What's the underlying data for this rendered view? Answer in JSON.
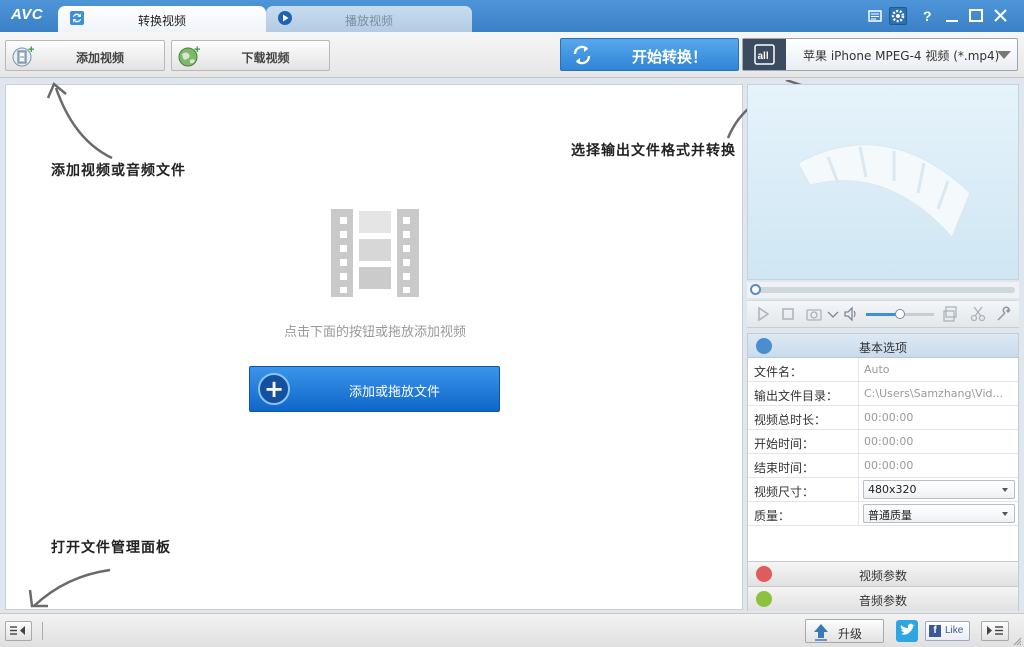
{
  "app": {
    "logo": "AVC"
  },
  "tabs": [
    {
      "label": "转换视频",
      "active": true
    },
    {
      "label": "播放视频",
      "active": false
    }
  ],
  "toolbar": {
    "add_video": "添加视频",
    "download_video": "下载视频",
    "start_convert": "开始转换！",
    "format_badge": "all",
    "format_selected": "苹果 iPhone MPEG-4 视频 (*.mp4)"
  },
  "annotations": {
    "add_files": "添加视频或音频文件",
    "choose_format": "选择输出文件格式并转换",
    "open_file_panel": "打开文件管理面板"
  },
  "main": {
    "hint": "点击下面的按钮或拖放添加视频",
    "add_files_button": "添加或拖放文件"
  },
  "player": {
    "progress": 0,
    "volume": 0.5
  },
  "properties": {
    "header": "基本选项",
    "rows": [
      {
        "key": "文件名：",
        "value": "Auto"
      },
      {
        "key": "输出文件目录：",
        "value": "C:\\Users\\Samzhang\\Vid..."
      },
      {
        "key": "视频总时长：",
        "value": "00:00:00"
      },
      {
        "key": "开始时间：",
        "value": "00:00:00"
      },
      {
        "key": "结束时间：",
        "value": "00:00:00"
      },
      {
        "key": "视频尺寸：",
        "value": "480x320"
      },
      {
        "key": "质量：",
        "value": "普通质量"
      }
    ],
    "video_params": "视频参数",
    "audio_params": "音频参数"
  },
  "statusbar": {
    "upgrade": "升级",
    "like": "Like",
    "facebook_glyph": "f"
  },
  "colors": {
    "titlebar": "#3b80c6",
    "accent_blue": "#2f84d6",
    "add_button": "#0f66c9"
  }
}
